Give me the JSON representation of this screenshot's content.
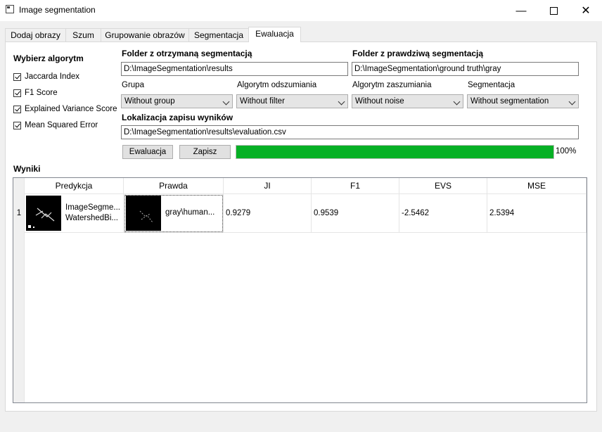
{
  "window": {
    "title": "Image segmentation"
  },
  "tabs": [
    "Dodaj obrazy",
    "Szum",
    "Grupowanie obrazów",
    "Segmentacja",
    "Ewaluacja"
  ],
  "algorithms": {
    "heading": "Wybierz algorytm",
    "items": [
      "Jaccarda Index",
      "F1 Score",
      "Explained Variance Score",
      "Mean Squared Error"
    ]
  },
  "folders": {
    "received_label": "Folder z otrzymaną segmentacją",
    "received_value": "D:\\ImageSegmentation\\results",
    "truth_label": "Folder z prawdziwą segmentacją",
    "truth_value": "D:\\ImageSegmentation\\ground truth\\gray"
  },
  "filters": {
    "group_label": "Grupa",
    "group_value": "Without group",
    "denoise_label": "Algorytm odszumiania",
    "denoise_value": "Without filter",
    "noise_label": "Algorytm zaszumiania",
    "noise_value": "Without noise",
    "seg_label": "Segmentacja",
    "seg_value": "Without segmentation"
  },
  "output": {
    "label": "Lokalizacja zapisu wyników",
    "value": "D:\\ImageSegmentation\\results\\evaluation.csv"
  },
  "actions": {
    "evaluate": "Ewaluacja",
    "save": "Zapisz"
  },
  "progress": {
    "value": 100,
    "label": "100%",
    "color": "#06b025"
  },
  "results": {
    "heading": "Wyniki",
    "columns": [
      "Predykcja",
      "Prawda",
      "JI",
      "F1",
      "EVS",
      "MSE"
    ],
    "rows": [
      {
        "index": "1",
        "prediction_line1": "ImageSegme...",
        "prediction_line2": "WatershedBi...",
        "truth": "gray\\human...",
        "ji": "0.9279",
        "f1": "0.9539",
        "evs": "-2.5462",
        "mse": "2.5394"
      }
    ]
  }
}
